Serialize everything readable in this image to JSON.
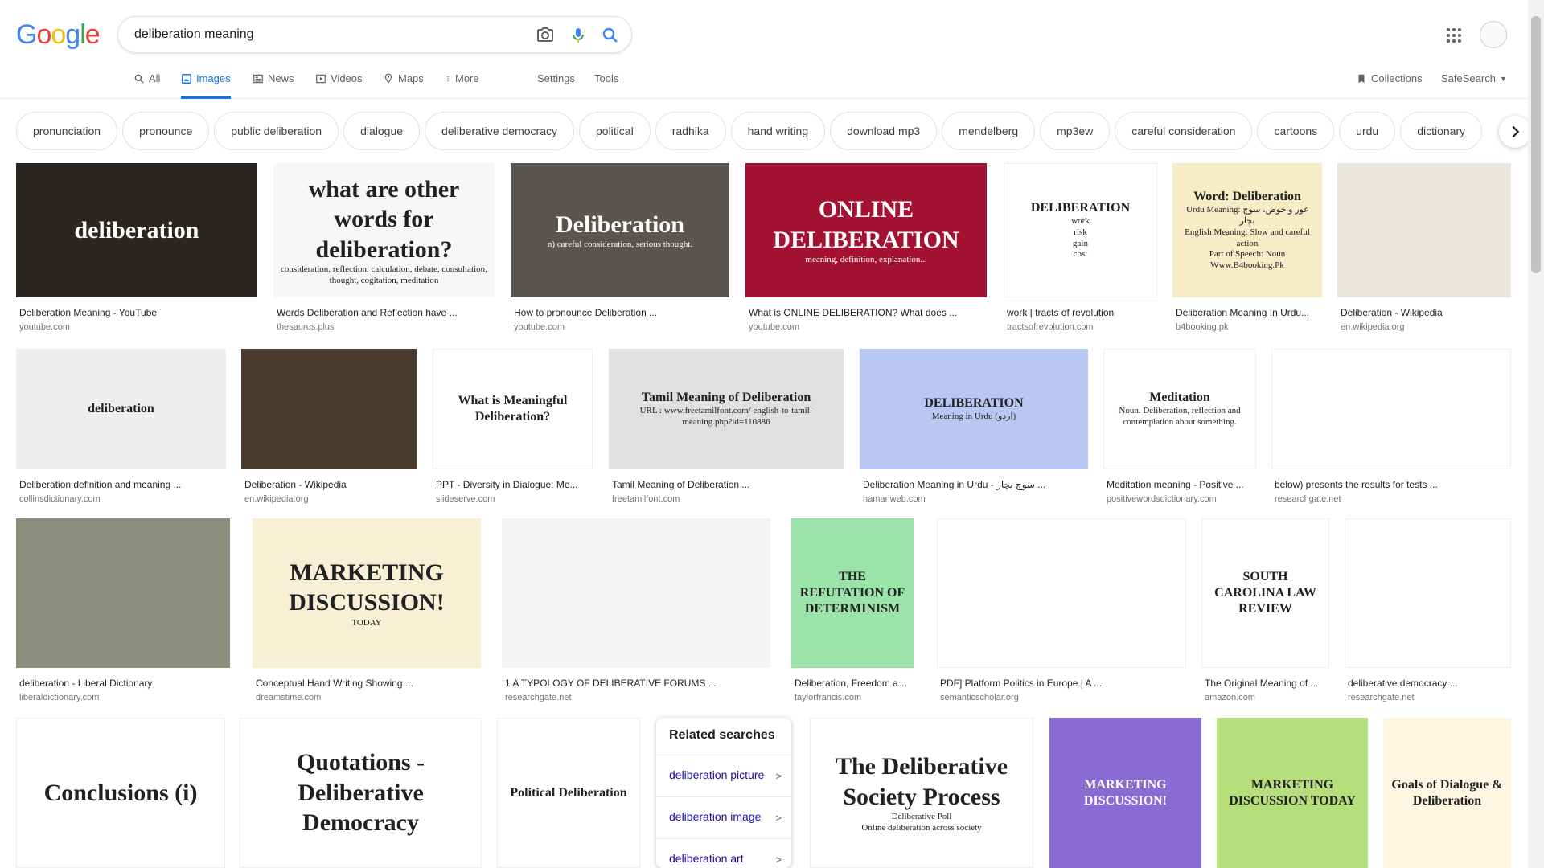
{
  "logo": {
    "letters": [
      "G",
      "o",
      "o",
      "g",
      "l",
      "e"
    ],
    "colors": [
      "#4285f4",
      "#ea4335",
      "#fbbc05",
      "#4285f4",
      "#34a853",
      "#ea4335"
    ]
  },
  "search": {
    "query": "deliberation meaning"
  },
  "tabs": [
    {
      "label": "All",
      "icon": "search-icon"
    },
    {
      "label": "Images",
      "icon": "image-icon",
      "active": true
    },
    {
      "label": "News",
      "icon": "news-icon"
    },
    {
      "label": "Videos",
      "icon": "video-icon"
    },
    {
      "label": "Maps",
      "icon": "maps-icon"
    },
    {
      "label": "More",
      "icon": "more-vert-icon"
    },
    {
      "label": "Settings"
    },
    {
      "label": "Tools"
    }
  ],
  "right_links": {
    "collections": "Collections",
    "safesearch": "SafeSearch"
  },
  "chips": [
    "pronunciation",
    "pronounce",
    "public deliberation",
    "dialogue",
    "deliberative democracy",
    "political",
    "radhika",
    "hand writing",
    "download mp3",
    "mendelberg",
    "mp3ew",
    "careful consideration",
    "cartoons",
    "urdu",
    "dictionary"
  ],
  "results": [
    {
      "caption": "Deliberation Meaning - YouTube",
      "source": "youtube.com",
      "thumb_text": "deliberation"
    },
    {
      "caption": "Words Deliberation and Reflection have ...",
      "source": "thesaurus.plus",
      "thumb_text": "what are other words for deliberation?",
      "thumb_text2": "consideration, reflection, calculation, debate, consultation, thought, cogitation, meditation"
    },
    {
      "caption": "How to pronounce Deliberation ...",
      "source": "youtube.com",
      "thumb_text": "Deliberation",
      "thumb_text2": "n) careful consideration, serious thought."
    },
    {
      "caption": "What is ONLINE DELIBERATION? What does ...",
      "source": "youtube.com",
      "thumb_text": "ONLINE DELIBERATION",
      "thumb_text2": "meaning, definition, explanation..."
    },
    {
      "caption": "work | tracts of revolution",
      "source": "tractsofrevolution.com",
      "thumb_text": "DELIBERATION",
      "thumb_text2": "work",
      "thumb_text3": "risk",
      "thumb_text4": "gain",
      "thumb_text5": "cost"
    },
    {
      "caption": "Deliberation Meaning In Urdu...",
      "source": "b4booking.pk",
      "thumb_text": "Word: Deliberation",
      "thumb_text2": "Urdu Meaning: غور و خوض، سوچ بچار",
      "thumb_text3": "English Meaning: Slow and careful action",
      "thumb_text4": "Part of Speech: Noun",
      "thumb_text5": "Www.B4booking.Pk"
    },
    {
      "caption": "Deliberation - Wikipedia",
      "source": "en.wikipedia.org"
    },
    {
      "caption": "Deliberation definition and meaning ...",
      "source": "collinsdictionary.com",
      "thumb_text": "deliberation"
    },
    {
      "caption": "Deliberation - Wikipedia",
      "source": "en.wikipedia.org"
    },
    {
      "caption": "PPT - Diversity in Dialogue: Me...",
      "source": "slideserve.com",
      "thumb_text": "What is Meaningful Deliberation?"
    },
    {
      "caption": "Tamil Meaning of Deliberation ...",
      "source": "freetamilfont.com",
      "thumb_text": "Tamil Meaning of Deliberation",
      "thumb_text2": "URL : www.freetamilfont.com/ english-to-tamil-meaning.php?id=110886"
    },
    {
      "caption": "Deliberation Meaning in Urdu - سوچ بچار ...",
      "source": "hamariweb.com",
      "thumb_text": "DELIBERATION",
      "thumb_text2": "Meaning in Urdu (اردو)"
    },
    {
      "caption": "Meditation meaning - Positive ...",
      "source": "positivewordsdictionary.com",
      "thumb_text": "Meditation",
      "thumb_text2": "Noun. Deliberation, reflection and contemplation about something."
    },
    {
      "caption": "below) presents the results for tests ...",
      "source": "researchgate.net"
    },
    {
      "caption": "deliberation - Liberal Dictionary",
      "source": "liberaldictionary.com"
    },
    {
      "caption": "Conceptual Hand Writing Showing ...",
      "source": "dreamstime.com",
      "thumb_text": "MARKETING DISCUSSION!",
      "thumb_text2": "TODAY"
    },
    {
      "caption": "1 A TYPOLOGY OF DELIBERATIVE FORUMS ...",
      "source": "researchgate.net"
    },
    {
      "caption": "Deliberation, Freedom an...",
      "source": "taylorfrancis.com",
      "thumb_text": "THE REFUTATION OF DETERMINISM"
    },
    {
      "caption": "PDF] Platform Politics in Europe | A ...",
      "source": "semanticscholar.org"
    },
    {
      "caption": "The Original Meaning of ...",
      "source": "amazon.com",
      "thumb_text": "SOUTH CAROLINA LAW REVIEW"
    },
    {
      "caption": "deliberative democracy ...",
      "source": "researchgate.net"
    },
    {
      "thumb_text": "Conclusions (i)"
    },
    {
      "thumb_text": "Quotations - Deliberative Democracy"
    },
    {
      "thumb_text": "Political Deliberation"
    },
    {
      "thumb_text": "The Deliberative Society Process",
      "thumb_text2": "Deliberative Poll",
      "thumb_text3": "Online deliberation across society"
    },
    {
      "thumb_text": "MARKETING DISCUSSION!"
    },
    {
      "thumb_text": "MARKETING DISCUSSION TODAY"
    },
    {
      "thumb_text": "Goals of Dialogue & Deliberation"
    }
  ],
  "related": {
    "title": "Related searches",
    "items": [
      "deliberation picture",
      "deliberation image",
      "deliberation art"
    ]
  }
}
